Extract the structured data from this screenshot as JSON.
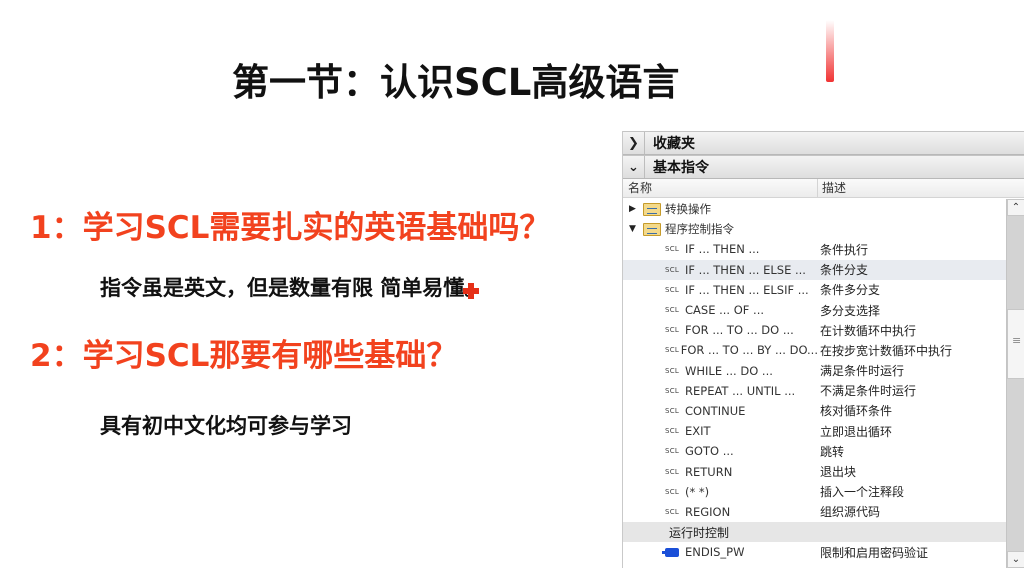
{
  "slide": {
    "title": "第一节：认识SCL高级语言",
    "question1": "1：学习SCL需要扎实的英语基础吗？",
    "answer1": "指令虽是英文，但是数量有限  简单易懂。",
    "question2": "2：学习SCL那要有哪些基础？",
    "answer2": "具有初中文化均可参与学习",
    "accent_color": "#f2421e"
  },
  "panel": {
    "favorites_label": "收藏夹",
    "basic_label": "基本指令",
    "columns": {
      "name": "名称",
      "description": "描述"
    },
    "folders": [
      {
        "label": "转换操作",
        "expanded": false
      },
      {
        "label": "程序控制指令",
        "expanded": true
      }
    ],
    "instructions": [
      {
        "name": "IF ... THEN ...",
        "desc": "条件执行"
      },
      {
        "name": "IF ... THEN ... ELSE ...",
        "desc": "条件分支",
        "selected": true
      },
      {
        "name": "IF ... THEN ... ELSIF ...",
        "desc": "条件多分支"
      },
      {
        "name": "CASE ... OF ...",
        "desc": "多分支选择"
      },
      {
        "name": "FOR ... TO ... DO ...",
        "desc": "在计数循环中执行"
      },
      {
        "name": "FOR ... TO ... BY ... DO...",
        "desc": "在按步宽计数循环中执行"
      },
      {
        "name": "WHILE ... DO ...",
        "desc": "满足条件时运行"
      },
      {
        "name": "REPEAT ... UNTIL ...",
        "desc": "不满足条件时运行"
      },
      {
        "name": "CONTINUE",
        "desc": "核对循环条件"
      },
      {
        "name": "EXIT",
        "desc": "立即退出循环"
      },
      {
        "name": "GOTO ...",
        "desc": "跳转"
      },
      {
        "name": "RETURN",
        "desc": "退出块"
      },
      {
        "name": "(* *)",
        "desc": "插入一个注释段"
      },
      {
        "name": "REGION",
        "desc": "组织源代码"
      }
    ],
    "scl_tag": "SCL",
    "runtime_group": "运行时控制",
    "runtime_items": [
      {
        "name": "ENDIS_PW",
        "desc": "限制和启用密码验证"
      }
    ]
  }
}
